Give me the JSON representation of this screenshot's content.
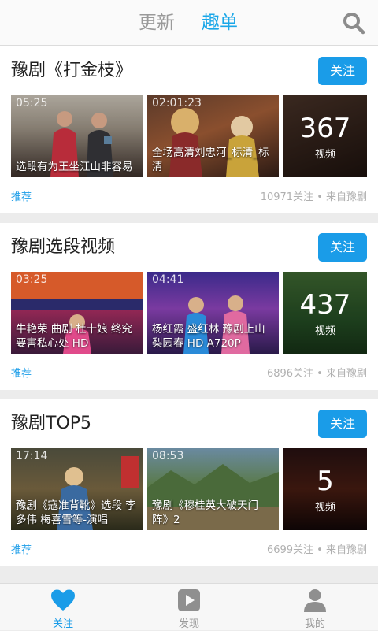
{
  "header": {
    "tabs": [
      {
        "label": "更新",
        "active": false
      },
      {
        "label": "趣单",
        "active": true
      }
    ],
    "search_icon": "search-icon"
  },
  "playlists": [
    {
      "title": "豫剧《打金枝》",
      "follow_label": "关注",
      "videos": [
        {
          "duration": "05:25",
          "caption": "选段有为王坐江山非容易"
        },
        {
          "duration": "02:01:23",
          "caption": "全场高清刘忠河_标清_标清"
        }
      ],
      "count": "367",
      "count_label": "视频",
      "tag": "推荐",
      "meta": "10971关注 • 来自豫剧"
    },
    {
      "title": "豫剧选段视频",
      "follow_label": "关注",
      "videos": [
        {
          "duration": "03:25",
          "caption": "牛艳荣 曲剧 杜十娘 终究要害私心处 HD"
        },
        {
          "duration": "04:41",
          "caption": "杨红霞 盛红林 豫剧上山 梨园春 HD A720P"
        }
      ],
      "count": "437",
      "count_label": "视频",
      "tag": "推荐",
      "meta": "6896关注 • 来自豫剧"
    },
    {
      "title": "豫剧TOP5",
      "follow_label": "关注",
      "videos": [
        {
          "duration": "17:14",
          "caption": "豫剧《寇准背靴》选段 李多伟 梅喜雪等-演唱"
        },
        {
          "duration": "08:53",
          "caption": "豫剧《穆桂英大破天门阵》2"
        }
      ],
      "count": "5",
      "count_label": "视频",
      "tag": "推荐",
      "meta": "6699关注 • 来自豫剧"
    }
  ],
  "bottom_nav": [
    {
      "label": "关注",
      "icon": "heart-icon",
      "active": true
    },
    {
      "label": "发现",
      "icon": "play-icon",
      "active": false
    },
    {
      "label": "我的",
      "icon": "user-icon",
      "active": false
    }
  ],
  "colors": {
    "accent": "#1a9ce8",
    "inactive": "#9a9a9a"
  }
}
